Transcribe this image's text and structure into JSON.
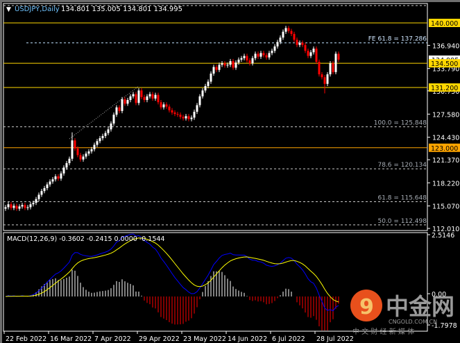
{
  "header": {
    "symbol_timeframe": "USDJPY,Daily",
    "ohlc_text": "134.801 135.005 134.801 134.995"
  },
  "macd": {
    "label": "MACD(12,26,9) -0.3602 -0.2415 0.0000 -0.1544",
    "axis_ticks": [
      "2.5146",
      "0.00",
      "-1.7978"
    ]
  },
  "colors": {
    "up": "#ffffff",
    "down": "#ff0000",
    "level": "#ffd700",
    "level_orange": "#ffa500",
    "macd_line": "#0000ff",
    "signal_line": "#ffff00",
    "background": "#000000"
  },
  "watermark": {
    "brand_cn": "中金网",
    "domain": "CNGOLD.COM.CN",
    "tagline": "中 文 财 经 新 媒 体"
  },
  "chart_data": {
    "type": "candlestick",
    "symbol": "USDJPY",
    "timeframe": "Daily",
    "ylim": [
      112.01,
      140.0
    ],
    "y_ticks": [
      "136.940",
      "133.790",
      "130.750",
      "127.580",
      "124.430",
      "121.370",
      "118.220",
      "115.070",
      "112.010"
    ],
    "x_ticks": [
      "22 Feb 2022",
      "16 Mar 2022",
      "7 Apr 2022",
      "29 Apr 2022",
      "23 May 2022",
      "14 Jun 2022",
      "6 Jul 2022",
      "28 Jul 2022"
    ],
    "closes": [
      114.9,
      115.3,
      114.8,
      115.1,
      114.7,
      115.0,
      115.2,
      114.8,
      114.9,
      115.3,
      115.5,
      116.0,
      116.6,
      117.1,
      117.5,
      118.0,
      118.4,
      118.7,
      119.1,
      118.8,
      119.5,
      120.3,
      120.9,
      121.5,
      124.0,
      122.9,
      122.0,
      121.4,
      121.8,
      122.2,
      122.5,
      122.8,
      123.4,
      123.9,
      124.3,
      124.6,
      125.0,
      125.5,
      126.3,
      127.5,
      128.5,
      128.0,
      129.6,
      129.0,
      129.5,
      130.0,
      130.3,
      129.1,
      130.8,
      129.9,
      129.5,
      130.0,
      130.3,
      129.7,
      130.2,
      129.2,
      128.5,
      128.9,
      128.6,
      128.1,
      127.8,
      127.6,
      127.5,
      127.2,
      127.0,
      127.3,
      126.9,
      127.1,
      127.9,
      128.8,
      130.0,
      130.8,
      131.4,
      132.0,
      133.1,
      134.0,
      133.6,
      134.3,
      134.5,
      134.2,
      134.3,
      134.8,
      133.9,
      134.6,
      135.0,
      135.2,
      135.5,
      134.9,
      134.5,
      135.2,
      135.8,
      135.4,
      135.9,
      135.6,
      135.3,
      135.9,
      136.2,
      136.8,
      137.4,
      138.0,
      138.8,
      139.3,
      138.9,
      138.5,
      137.7,
      137.0,
      137.3,
      137.0,
      136.2,
      135.5,
      136.0,
      136.5,
      134.7,
      133.0,
      132.6,
      131.7,
      133.0,
      134.5,
      133.3,
      135.8,
      134.995
    ],
    "levels": [
      {
        "price": 140.0,
        "label": "140.000",
        "color": "#ffd700"
      },
      {
        "price": 134.5,
        "label": "134.500",
        "color": "#ffd700"
      },
      {
        "price": 131.2,
        "label": "131.200",
        "color": "#ffd700"
      },
      {
        "price": 123.0,
        "label": "123.000",
        "color": "#ffa500"
      }
    ],
    "current_price": "134.995",
    "fib_lines": [
      {
        "price": 137.286,
        "label": "FE 61.8 = 137.286"
      },
      {
        "price": 125.848,
        "label": "100.0 = 125.848"
      },
      {
        "price": 120.134,
        "label": "78.6 = 120.134"
      },
      {
        "price": 115.648,
        "label": "61.8 = 115.648"
      },
      {
        "price": 112.498,
        "label": "50.0 = 112.498"
      }
    ]
  }
}
